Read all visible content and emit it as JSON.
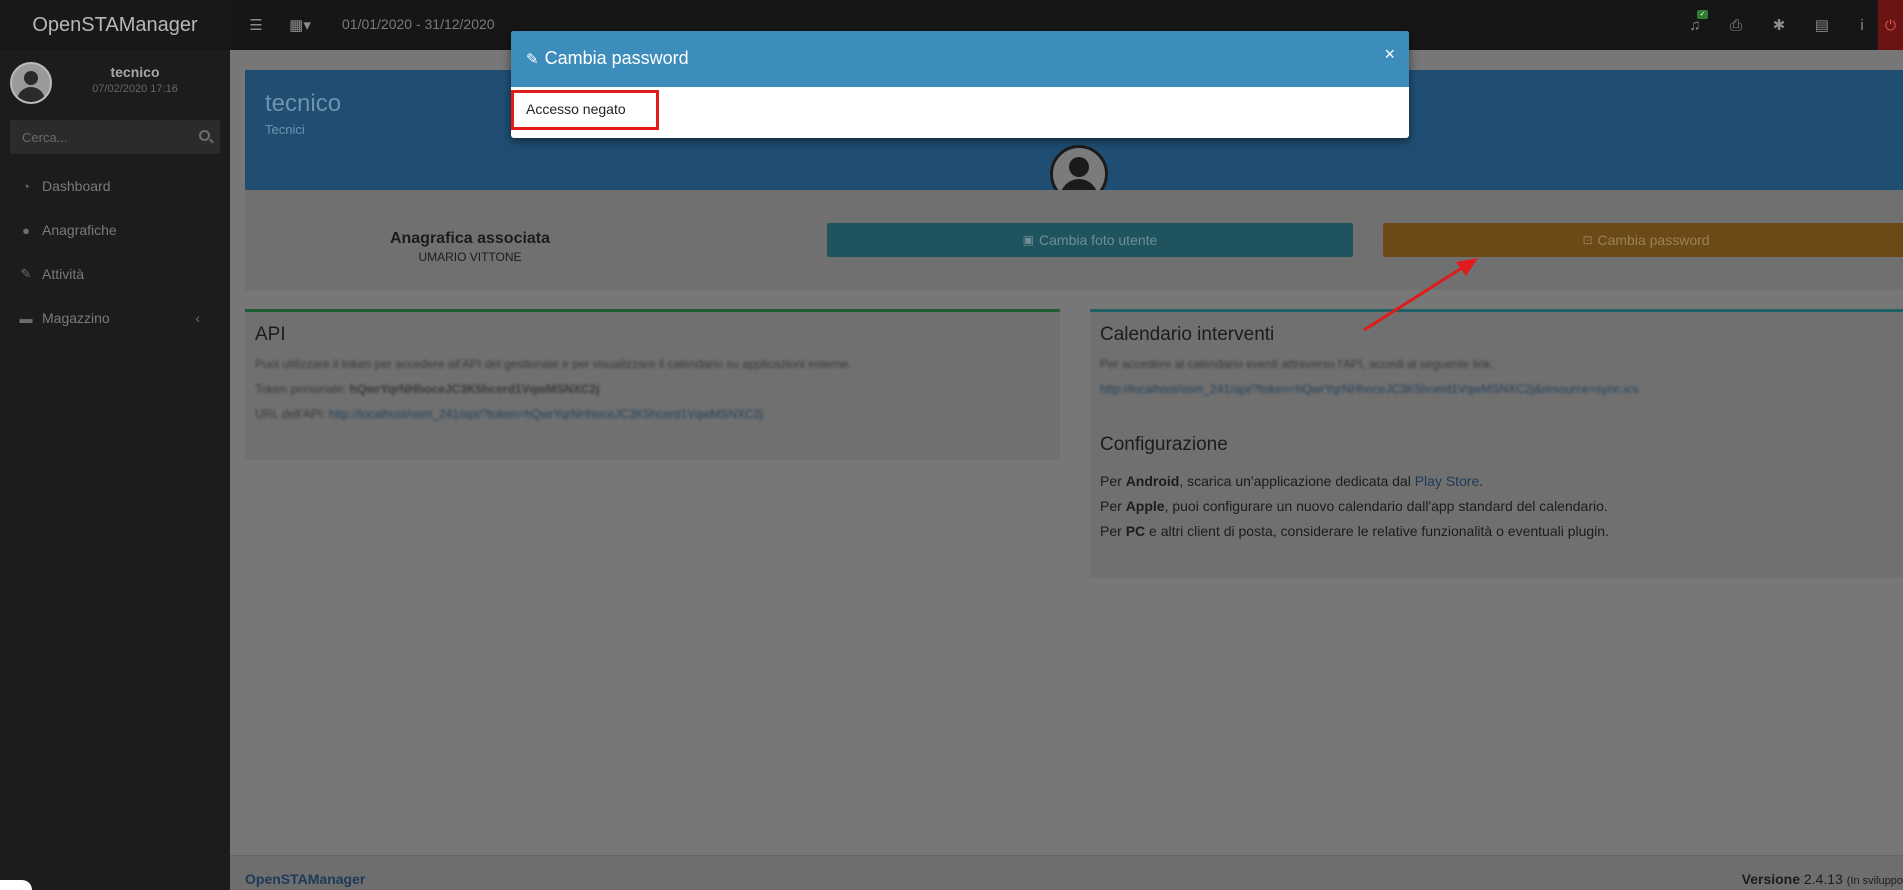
{
  "app": {
    "brand": "OpenSTAManager"
  },
  "user": {
    "name": "tecnico",
    "last_login": "07/02/2020 17:16"
  },
  "sidebar": {
    "search_placeholder": "Cerca...",
    "items": [
      {
        "label": "Dashboard",
        "icon": "dashboard-icon"
      },
      {
        "label": "Anagrafiche",
        "icon": "users-icon"
      },
      {
        "label": "Attività",
        "icon": "wrench-icon"
      },
      {
        "label": "Magazzino",
        "icon": "truck-icon"
      }
    ]
  },
  "topbar": {
    "date_range": "01/01/2020 - 31/12/2020"
  },
  "profile": {
    "title": "tecnico",
    "group": "Tecnici",
    "assoc_title": "Anagrafica associata",
    "assoc_name": "UMARIO VITTONE",
    "btn_photo": "Cambia foto utente",
    "btn_password": "Cambia password"
  },
  "api_panel": {
    "title": "API",
    "line1": "Puoi utilizzare il token per accedere all'API del gestionale e per visualizzare il calendario su applicazioni esterne.",
    "token_label": "Token personale:",
    "token_value": "hQwrYqrNHhoceJC3K5hcerd1VqwMSNXC2j",
    "url_label": "URL dell'API:",
    "url_value": "http://localhost/osm_241/api/?token=hQwrYqrNHhoceJC3K5hcerd1VqwMSNXC2j"
  },
  "cal_panel": {
    "title": "Calendario interventi",
    "line1": "Per accedere al calendario eventi attraverso l'API, accedi al seguente link:",
    "link": "http://localhost/osm_241/api/?token=hQwrYqrNHhoceJC3K5hcerd1VqwMSNXC2j&resource=sync.ics",
    "config_title": "Configurazione",
    "android": {
      "pre": "Per ",
      "bold": "Android",
      "mid": ", scarica un'applicazione dedicata dal ",
      "link": "Play Store",
      "post": "."
    },
    "apple": {
      "pre": "Per ",
      "bold": "Apple",
      "post": ", puoi configurare un nuovo calendario dall'app standard del calendario."
    },
    "pc": {
      "pre": "Per ",
      "bold": "PC",
      "post": " e altri client di posta, considerare le relative funzionalità o eventuali plugin."
    }
  },
  "footer": {
    "left": "OpenSTAManager",
    "version_label": "Versione",
    "version": "2.4.13",
    "version_note": "(In sviluppo"
  },
  "modal": {
    "title": "Cambia password",
    "close": "×",
    "message": "Accesso negato"
  },
  "colors": {
    "modal_header": "#3c8dbc",
    "highlight": "#e01b1b",
    "arrow": "#e01b1b"
  }
}
